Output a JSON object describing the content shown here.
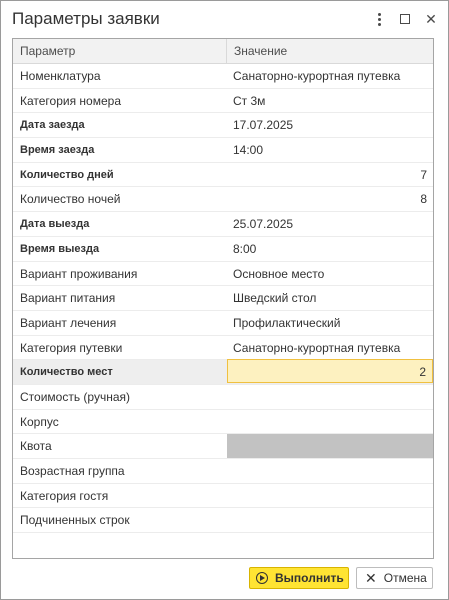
{
  "window": {
    "title": "Параметры заявки"
  },
  "grid": {
    "columns": [
      "Параметр",
      "Значение"
    ],
    "rows": [
      {
        "name": "Номенклатура",
        "value": "Санаторно-курортная путевка",
        "bold": false,
        "numeric": false
      },
      {
        "name": "Категория номера",
        "value": "Ст 3м",
        "bold": false,
        "numeric": false
      },
      {
        "name": "Дата заезда",
        "value": "17.07.2025",
        "bold": true,
        "numeric": false
      },
      {
        "name": "Время заезда",
        "value": "14:00",
        "bold": true,
        "numeric": false
      },
      {
        "name": "Количество дней",
        "value": "7",
        "bold": true,
        "numeric": true
      },
      {
        "name": "Количество ночей",
        "value": "8",
        "bold": false,
        "numeric": true
      },
      {
        "name": "Дата выезда",
        "value": "25.07.2025",
        "bold": true,
        "numeric": false
      },
      {
        "name": "Время выезда",
        "value": "8:00",
        "bold": true,
        "numeric": false
      },
      {
        "name": "Вариант проживания",
        "value": "Основное место",
        "bold": false,
        "numeric": false
      },
      {
        "name": "Вариант питания",
        "value": "Шведский стол",
        "bold": false,
        "numeric": false
      },
      {
        "name": "Вариант лечения",
        "value": "Профилактический",
        "bold": false,
        "numeric": false
      },
      {
        "name": "Категория путевки",
        "value": "Санаторно-курортная путевка",
        "bold": false,
        "numeric": false
      },
      {
        "name": "Количество мест",
        "value": "2",
        "bold": true,
        "numeric": true,
        "selected": true
      },
      {
        "name": "Стоимость (ручная)",
        "value": "",
        "bold": false,
        "numeric": false
      },
      {
        "name": "Корпус",
        "value": "",
        "bold": false,
        "numeric": false
      },
      {
        "name": "Квота",
        "value": "",
        "bold": false,
        "numeric": false,
        "disabled": true
      },
      {
        "name": "Возрастная группа",
        "value": "",
        "bold": false,
        "numeric": false
      },
      {
        "name": "Категория гостя",
        "value": "",
        "bold": false,
        "numeric": false
      },
      {
        "name": "Подчиненных строк",
        "value": "",
        "bold": false,
        "numeric": false
      }
    ]
  },
  "buttons": {
    "execute": "Выполнить",
    "cancel": "Отмена"
  },
  "colors": {
    "accent": "#ffe433",
    "selection": "#fdf1c0",
    "disabled_cell": "#c2c2c2"
  }
}
